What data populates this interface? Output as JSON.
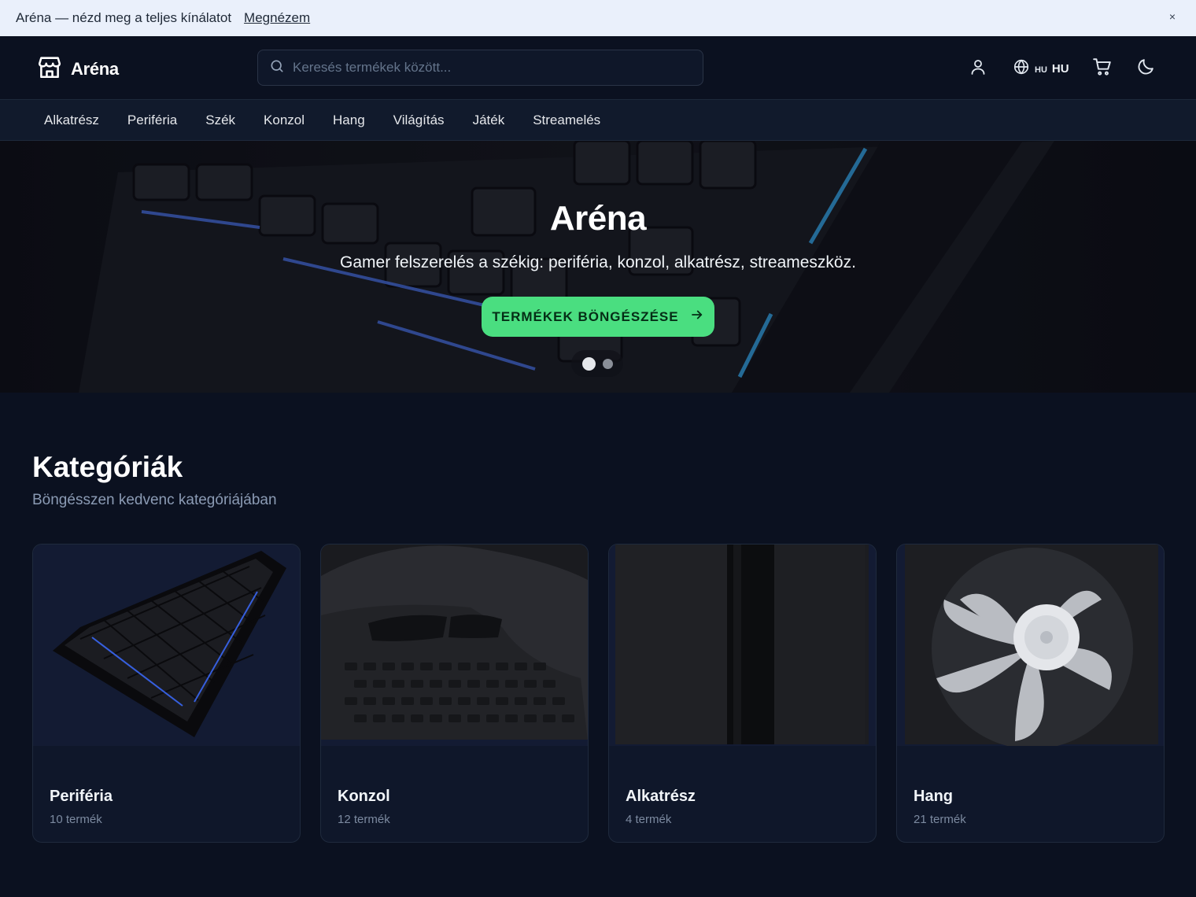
{
  "announcement": {
    "text": "Aréna — nézd meg a teljes kínálatot",
    "link": "Megnézem",
    "close": "×"
  },
  "header": {
    "brand": "Aréna",
    "search_placeholder": "Keresés termékek között...",
    "lang_small": "HU",
    "lang_big": "HU"
  },
  "nav": {
    "items": [
      "Alkatrész",
      "Periféria",
      "Szék",
      "Konzol",
      "Hang",
      "Világítás",
      "Játék",
      "Streamelés"
    ]
  },
  "hero": {
    "title": "Aréna",
    "subtitle": "Gamer felszerelés a székig: periféria, konzol, alkatrész, streameszköz.",
    "cta": "TERMÉKEK BÖNGÉSZÉSE",
    "slides_total": 2,
    "slide_active": 1
  },
  "categories": {
    "title": "Kategóriák",
    "subtitle": "Böngésszen kedvenc kategóriájában",
    "items": [
      {
        "name": "Periféria",
        "count": "10 termék"
      },
      {
        "name": "Konzol",
        "count": "12 termék"
      },
      {
        "name": "Alkatrész",
        "count": "4 termék"
      },
      {
        "name": "Hang",
        "count": "21 termék"
      }
    ]
  },
  "colors": {
    "background": "#0b1120",
    "accent": "#4ade80",
    "announcement_bg": "#eaf0fb"
  }
}
